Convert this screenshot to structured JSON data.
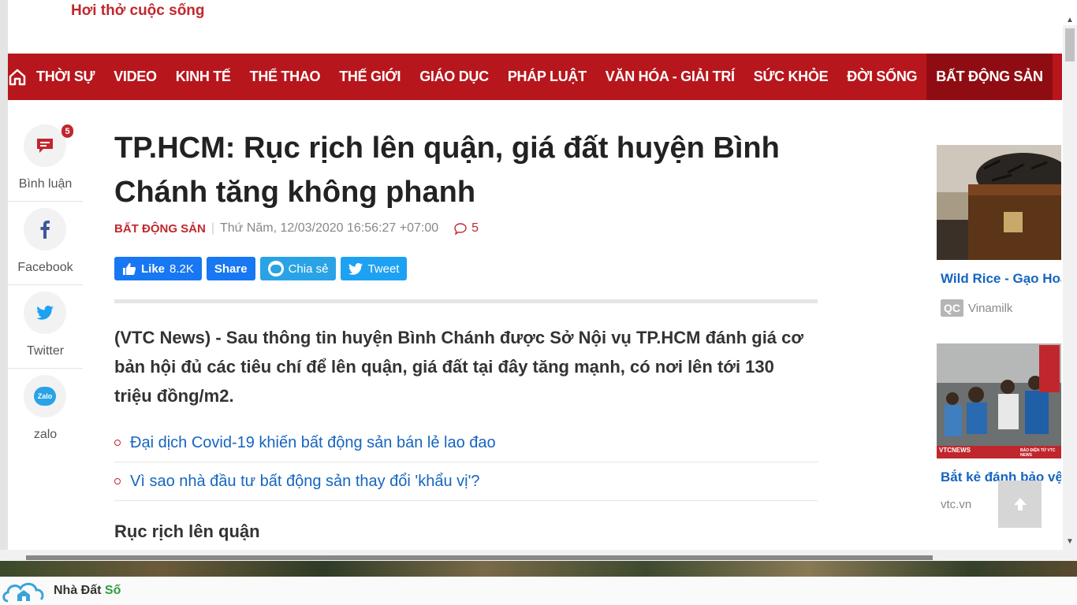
{
  "header": {
    "slogan": "Hơi thở cuộc sống"
  },
  "nav": {
    "items": [
      "THỜI SỰ",
      "VIDEO",
      "KINH TẾ",
      "THỂ THAO",
      "THẾ GIỚI",
      "GIÁO DỤC",
      "PHÁP LUẬT",
      "VĂN HÓA - GIẢI TRÍ",
      "SỨC KHỎE",
      "ĐỜI SỐNG",
      "BẤT ĐỘNG SẢN"
    ],
    "active": "BẤT ĐỘNG SẢN",
    "more": "•••"
  },
  "share_sidebar": {
    "comments_label": "Bình luận",
    "comments_count": "5",
    "facebook_label": "Facebook",
    "twitter_label": "Twitter",
    "zalo_label": "zalo",
    "zalo_icon_text": "Zalo"
  },
  "article": {
    "title": "TP.HCM: Rục rịch lên quận, giá đất huyện Bình Chánh tăng không phanh",
    "category": "BẤT ĐỘNG SẢN",
    "datetime": "Thứ Năm, 12/03/2020 16:56:27 +07:00",
    "comment_count": "5",
    "sapo": "(VTC News) - Sau thông tin huyện Bình Chánh được Sở Nội vụ TP.HCM đánh giá cơ bản hội đủ các tiêu chí để lên quận, giá đất tại đây tăng mạnh, có nơi lên tới 130 triệu đồng/m2.",
    "related": [
      "Đại dịch Covid-19 khiến bất động sản bán lẻ lao đao",
      "Vì sao nhà đầu tư bất động sản thay đổi 'khẩu vị'?"
    ],
    "subheading": "Rục rịch lên quận"
  },
  "social_buttons": {
    "like": "Like",
    "like_count": "8.2K",
    "share": "Share",
    "zalo_share": "Chia sẻ",
    "tweet": "Tweet"
  },
  "sidebar_ads": [
    {
      "caption": "Wild Rice - Gạo Hoang",
      "badge": "QC",
      "source": "Vinamilk"
    },
    {
      "caption": "Bắt kẻ đánh bảo vệ bệnh viện",
      "source": "vtc.vn",
      "overlay_left": "VTCNEWS",
      "overlay_right": "BÁO ĐIỆN TỬ VTC NEWS"
    }
  ],
  "bottom_logo": {
    "text_a": "Nhà Đất ",
    "text_b": "Số"
  },
  "colors": {
    "brand": "#b7161c",
    "active_nav": "#8f0d12",
    "link": "#1565c0"
  }
}
